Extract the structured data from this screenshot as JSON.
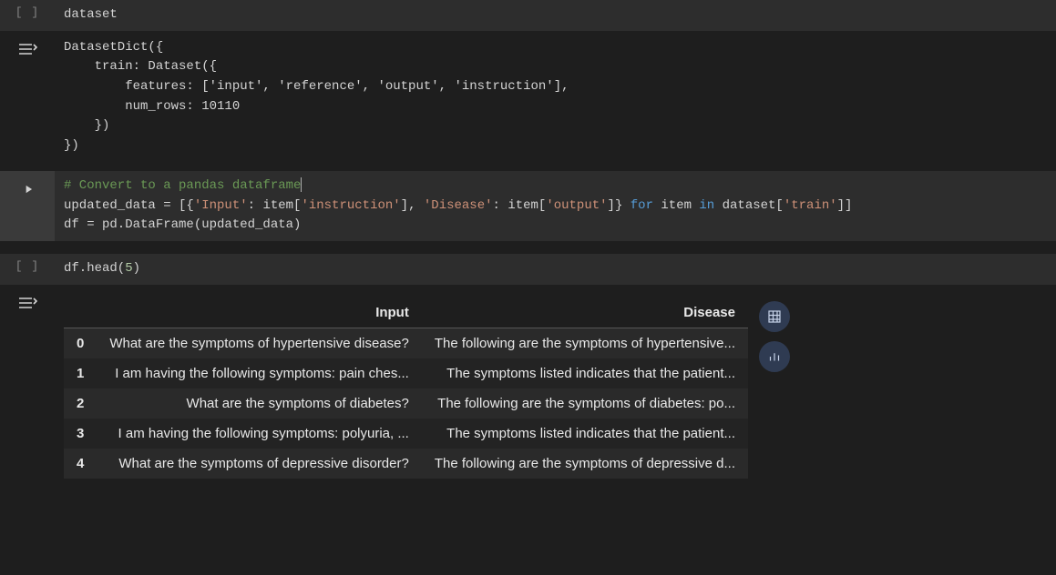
{
  "cell1": {
    "code": "dataset",
    "output_lines": [
      "DatasetDict({",
      "    train: Dataset({",
      "        features: ['input', 'reference', 'output', 'instruction'],",
      "        num_rows: 10110",
      "    })",
      "})"
    ]
  },
  "cell2": {
    "comment": "# Convert to a pandas dataframe",
    "line2": {
      "a": "updated_data = [{",
      "s1": "'Input'",
      "b": ": item[",
      "s2": "'instruction'",
      "c": "], ",
      "s3": "'Disease'",
      "d": ": item[",
      "s4": "'output'",
      "e": "]} ",
      "kw1": "for",
      "f": " item ",
      "kw2": "in",
      "g": " dataset[",
      "s5": "'train'",
      "h": "]]"
    },
    "line3": {
      "a": "df = pd.DataFrame(updated_data)"
    }
  },
  "cell3": {
    "code_a": "df.head(",
    "code_n": "5",
    "code_b": ")"
  },
  "df": {
    "columns": [
      "Input",
      "Disease"
    ],
    "rows": [
      {
        "idx": "0",
        "input": "What are the symptoms of hypertensive disease?",
        "disease": "The following are the symptoms of hypertensive..."
      },
      {
        "idx": "1",
        "input": "I am having the following symptoms: pain ches...",
        "disease": "The symptoms listed indicates that the patient..."
      },
      {
        "idx": "2",
        "input": "What are the symptoms of diabetes?",
        "disease": "The following are the symptoms of diabetes: po..."
      },
      {
        "idx": "3",
        "input": "I am having the following symptoms: polyuria, ...",
        "disease": "The symptoms listed indicates that the patient..."
      },
      {
        "idx": "4",
        "input": "What are the symptoms of depressive disorder?",
        "disease": "The following are the symptoms of depressive d..."
      }
    ]
  }
}
